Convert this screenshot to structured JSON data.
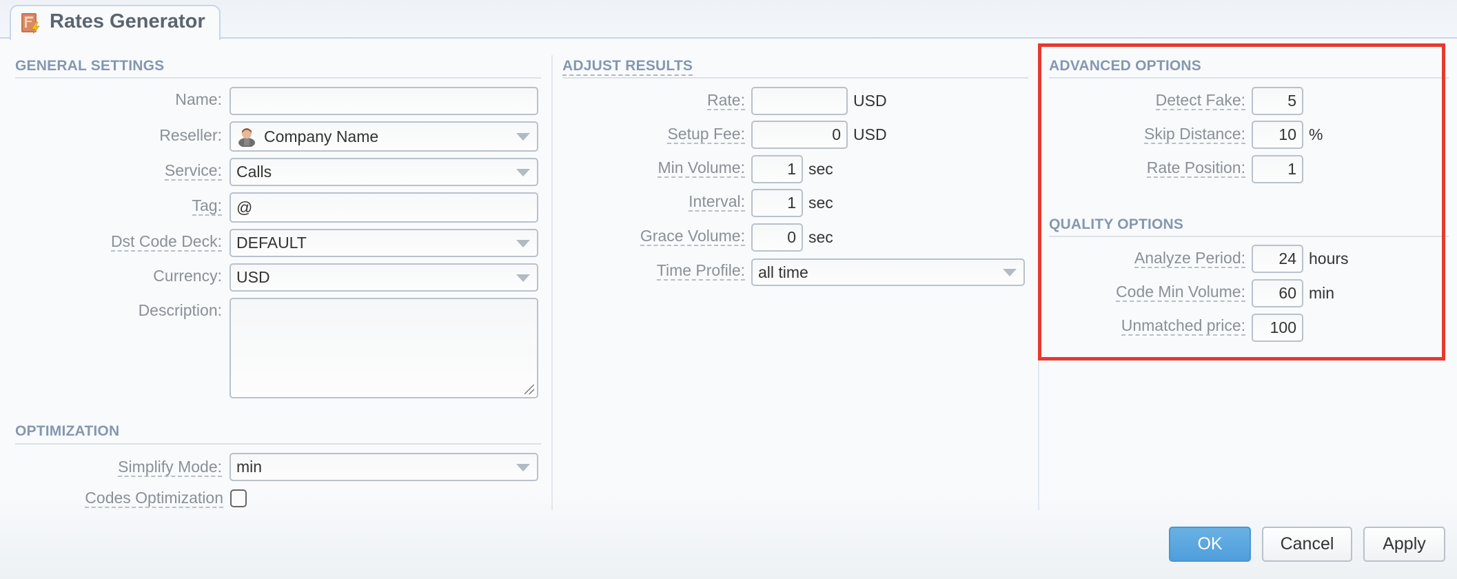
{
  "tab": {
    "title": "Rates Generator",
    "icon": "rates-generator-icon"
  },
  "general_settings": {
    "heading": "GENERAL SETTINGS",
    "name": {
      "label": "Name:",
      "value": ""
    },
    "reseller": {
      "label": "Reseller:",
      "value": "Company Name",
      "icon": "user-avatar-icon"
    },
    "service": {
      "label": "Service:",
      "value": "Calls"
    },
    "tag": {
      "label": "Tag:",
      "value": "@"
    },
    "dst_code_deck": {
      "label": "Dst Code Deck:",
      "value": "DEFAULT"
    },
    "currency": {
      "label": "Currency:",
      "value": "USD"
    },
    "description": {
      "label": "Description:",
      "value": ""
    }
  },
  "optimization": {
    "heading": "OPTIMIZATION",
    "simplify_mode": {
      "label": "Simplify Mode:",
      "value": "min"
    },
    "codes_optimization": {
      "label": "Codes Optimization",
      "checked": false
    }
  },
  "adjust_results": {
    "heading": "ADJUST RESULTS",
    "rate": {
      "label": "Rate:",
      "value": "",
      "unit": "USD"
    },
    "setup_fee": {
      "label": "Setup Fee:",
      "value": "0",
      "unit": "USD"
    },
    "min_volume": {
      "label": "Min Volume:",
      "value": "1",
      "unit": "sec"
    },
    "interval": {
      "label": "Interval:",
      "value": "1",
      "unit": "sec"
    },
    "grace_volume": {
      "label": "Grace Volume:",
      "value": "0",
      "unit": "sec"
    },
    "time_profile": {
      "label": "Time Profile:",
      "value": "all time"
    }
  },
  "advanced_options": {
    "heading": "ADVANCED OPTIONS",
    "detect_fake": {
      "label": "Detect Fake:",
      "value": "5"
    },
    "skip_distance": {
      "label": "Skip Distance:",
      "value": "10",
      "unit": "%"
    },
    "rate_position": {
      "label": "Rate Position:",
      "value": "1"
    }
  },
  "quality_options": {
    "heading": "QUALITY OPTIONS",
    "analyze_period": {
      "label": "Analyze Period:",
      "value": "24",
      "unit": "hours"
    },
    "code_min_volume": {
      "label": "Code Min Volume:",
      "value": "60",
      "unit": "min"
    },
    "unmatched_price": {
      "label": "Unmatched price:",
      "value": "100"
    }
  },
  "highlight": {
    "color": "#e8392e"
  },
  "buttons": {
    "ok": "OK",
    "cancel": "Cancel",
    "apply": "Apply",
    "primary_color": "#5aa6e0"
  }
}
